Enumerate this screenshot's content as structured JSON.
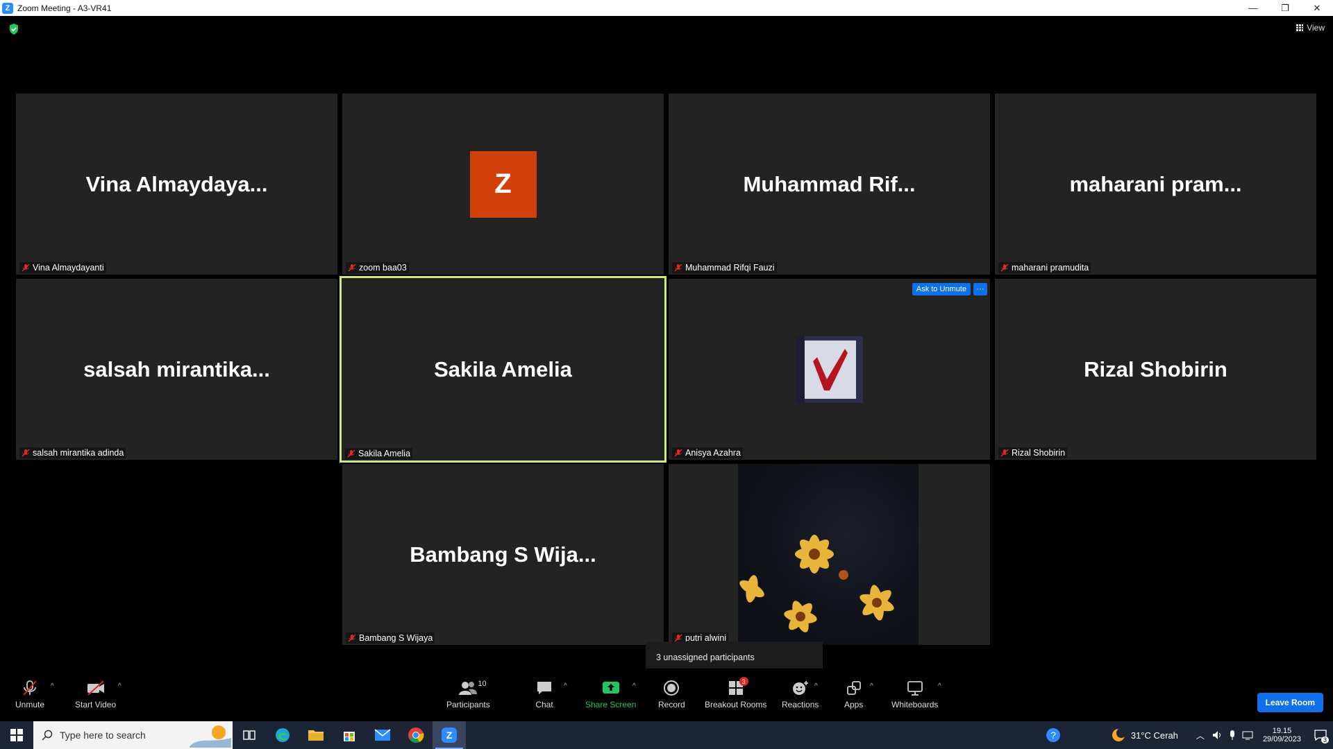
{
  "window": {
    "title": "Zoom Meeting - A3-VR41",
    "minimize": "—",
    "restore": "❐",
    "close": "✕"
  },
  "header": {
    "view_label": "View"
  },
  "tiles": [
    {
      "big": "Vina  Almaydaya...",
      "label": "Vina Almaydayanti"
    },
    {
      "big": "",
      "avatar": "Z",
      "label": "zoom baa03"
    },
    {
      "big": "Muhammad  Rif...",
      "label": "Muhammad Rifqi Fauzi"
    },
    {
      "big": "maharani  pram...",
      "label": "maharani pramudita"
    },
    {
      "big": "salsah  mirantika...",
      "label": "salsah mirantika adinda"
    },
    {
      "big": "Sakila Amelia",
      "label": "Sakila Amelia"
    },
    {
      "big": "",
      "label": "Anisya Azahra",
      "ask_unmute": "Ask to Unmute",
      "more": "···"
    },
    {
      "big": "Rizal Shobirin",
      "label": "Rizal Shobirin"
    },
    {
      "big": "Bambang  S  Wija...",
      "label": "Bambang S Wijaya"
    },
    {
      "big": "",
      "label": "putri alwini"
    }
  ],
  "tooltip": "3 unassigned participants",
  "toolbar": {
    "unmute": "Unmute",
    "start_video": "Start Video",
    "participants": "Participants",
    "participants_count": "10",
    "chat": "Chat",
    "share_screen": "Share Screen",
    "record": "Record",
    "breakout_rooms": "Breakout Rooms",
    "breakout_badge": "3",
    "reactions": "Reactions",
    "apps": "Apps",
    "whiteboards": "Whiteboards",
    "leave_room": "Leave Room",
    "caret": "^"
  },
  "taskbar": {
    "search_placeholder": "Type here to search",
    "weather": "31°C  Cerah",
    "time": "19.15",
    "date": "29/09/2023",
    "notification_count": "3"
  },
  "colors": {
    "accent": "#0E71EB",
    "active_speaker": "#CDEB7B",
    "share_green": "#23C55E",
    "avatar_z": "#D2410B",
    "muted_red": "#E02828"
  }
}
